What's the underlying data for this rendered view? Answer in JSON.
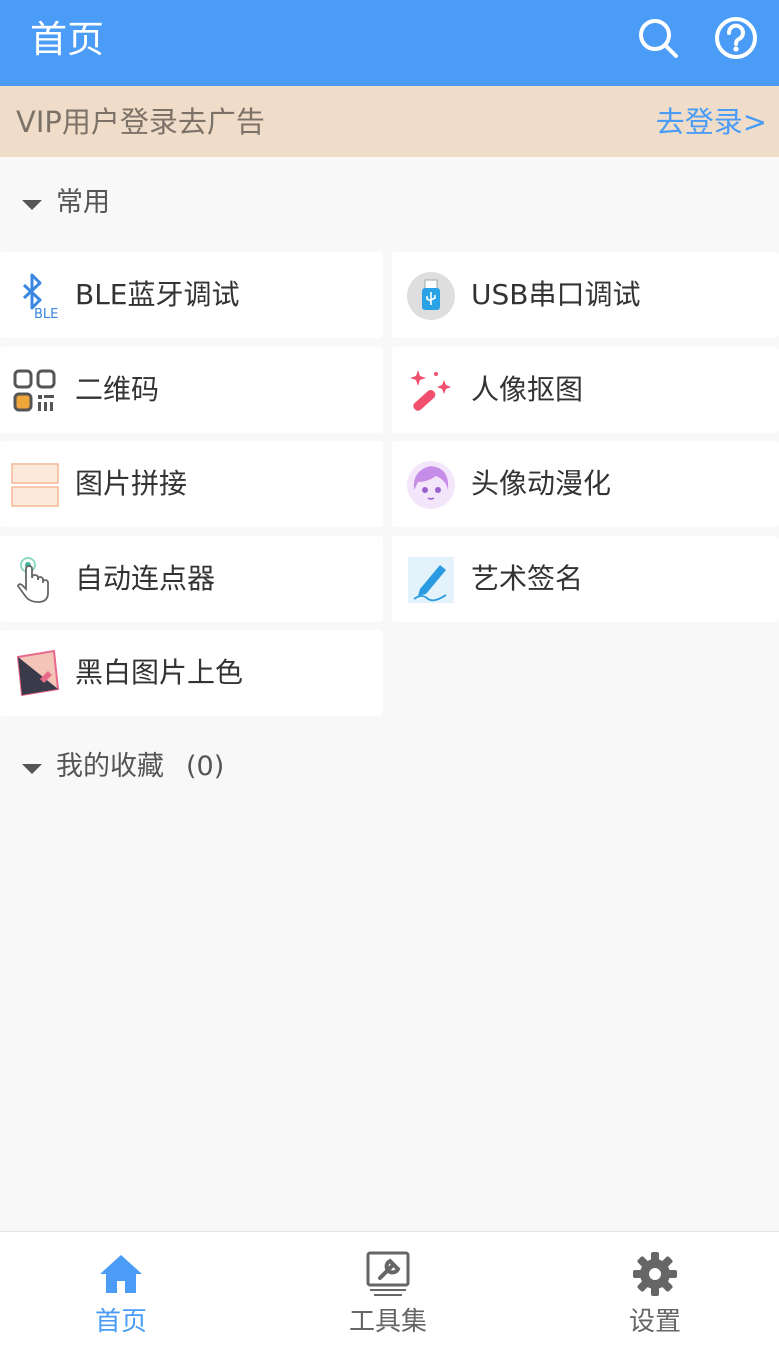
{
  "header": {
    "title": "首页"
  },
  "vip_banner": {
    "text": "VIP用户登录去广告",
    "login_link": "去登录>"
  },
  "sections": {
    "common": {
      "label": "常用"
    },
    "favorites": {
      "label": "我的收藏",
      "count": "(0)"
    }
  },
  "tools": [
    {
      "label": "BLE蓝牙调试",
      "icon": "bluetooth-icon"
    },
    {
      "label": "USB串口调试",
      "icon": "usb-icon"
    },
    {
      "label": "二维码",
      "icon": "qrcode-icon"
    },
    {
      "label": "人像抠图",
      "icon": "magic-wand-icon"
    },
    {
      "label": "图片拼接",
      "icon": "image-stitch-icon"
    },
    {
      "label": "头像动漫化",
      "icon": "anime-avatar-icon"
    },
    {
      "label": "自动连点器",
      "icon": "tap-finger-icon"
    },
    {
      "label": "艺术签名",
      "icon": "pen-icon"
    },
    {
      "label": "黑白图片上色",
      "icon": "colorize-icon"
    }
  ],
  "bottom_nav": [
    {
      "label": "首页",
      "icon": "home-icon",
      "active": true
    },
    {
      "label": "工具集",
      "icon": "toolbox-icon",
      "active": false
    },
    {
      "label": "设置",
      "icon": "gear-icon",
      "active": false
    }
  ],
  "colors": {
    "primary": "#4a9cf6",
    "banner_bg": "#efdcc9",
    "inactive_tab": "#666666"
  }
}
